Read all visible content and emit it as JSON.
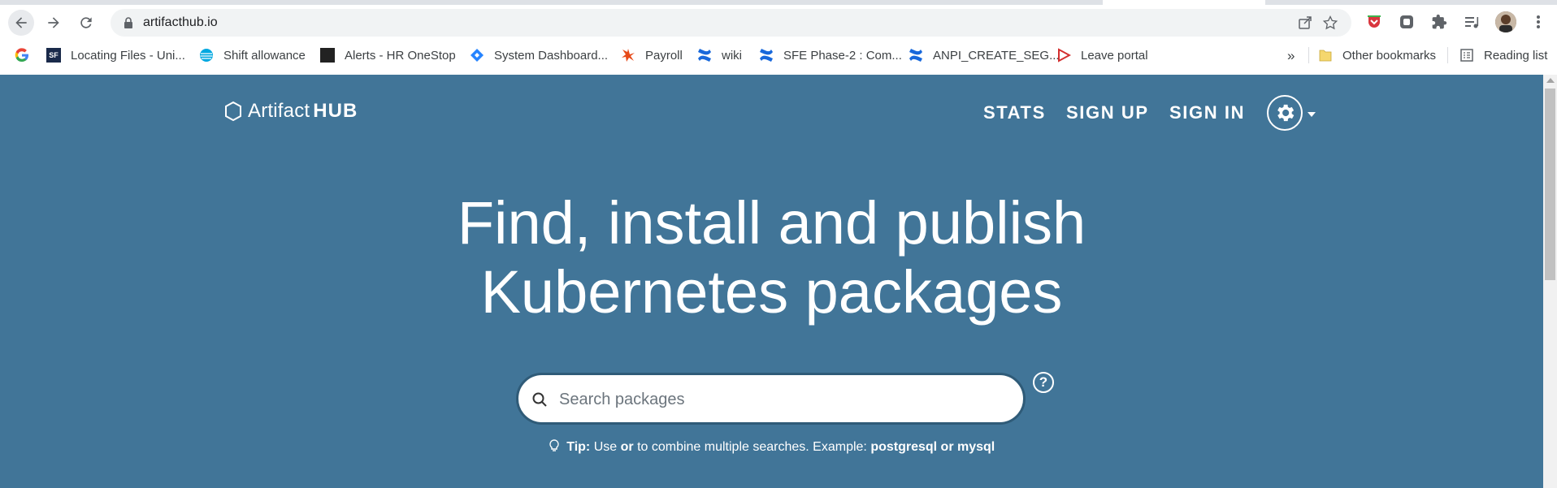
{
  "browser": {
    "url": "artifacthub.io",
    "bookmarks": [
      {
        "label": "",
        "icon": "google-icon"
      },
      {
        "label": "Locating Files - Uni...",
        "icon": "sf-icon"
      },
      {
        "label": "Shift allowance",
        "icon": "att-icon"
      },
      {
        "label": "Alerts - HR OneStop",
        "icon": "hr-icon"
      },
      {
        "label": "System Dashboard...",
        "icon": "jira-icon"
      },
      {
        "label": "Payroll",
        "icon": "payroll-icon"
      },
      {
        "label": "wiki",
        "icon": "confluence-icon"
      },
      {
        "label": "SFE Phase-2 : Com...",
        "icon": "confluence-icon"
      },
      {
        "label": "ANPI_CREATE_SEG...",
        "icon": "confluence-icon"
      },
      {
        "label": "Leave portal",
        "icon": "leave-icon"
      }
    ],
    "overflow_label": "»",
    "other_bookmarks": "Other bookmarks",
    "reading_list": "Reading list"
  },
  "site": {
    "logo_light": "Artifact",
    "logo_bold": "HUB",
    "nav": {
      "stats": "STATS",
      "sign_up": "SIGN UP",
      "sign_in": "SIGN IN"
    },
    "headline_line1": "Find, install and publish",
    "headline_line2": "Kubernetes packages",
    "search_placeholder": "Search packages",
    "help_label": "?",
    "tip": {
      "label": "Tip:",
      "pre": "Use",
      "or": "or",
      "mid": "to combine multiple searches. Example:",
      "example": "postgresql or mysql"
    }
  },
  "colors": {
    "hero": "#417598",
    "search_border": "#2f5b78"
  }
}
